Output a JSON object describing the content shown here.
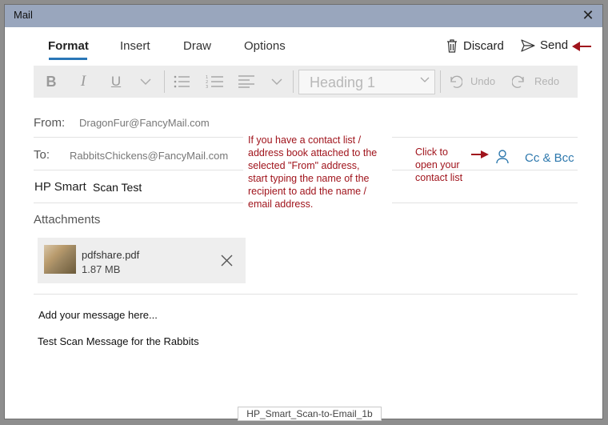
{
  "window": {
    "title": "Mail"
  },
  "tabs": [
    {
      "label": "Format",
      "active": true
    },
    {
      "label": "Insert",
      "active": false
    },
    {
      "label": "Draw",
      "active": false
    },
    {
      "label": "Options",
      "active": false
    }
  ],
  "actions": {
    "discard_label": "Discard",
    "send_label": "Send"
  },
  "toolbar": {
    "bold": "B",
    "italic": "I",
    "underline": "U",
    "heading_value": "Heading 1",
    "undo_label": "Undo",
    "redo_label": "Redo"
  },
  "form": {
    "from_label": "From:",
    "from_value": "DragonFur@FancyMail.com",
    "to_label": "To:",
    "to_value": "RabbitsChickens@FancyMail.com",
    "cc_bcc_label": "Cc & Bcc",
    "subject_label": "HP Smart",
    "subject_value": "Scan Test",
    "attachments_label": "Attachments"
  },
  "attachment": {
    "name": "pdfshare.pdf",
    "size": "1.87 MB"
  },
  "message": {
    "placeholder": "Add your message here...",
    "body": "Test Scan Message for the Rabbits"
  },
  "annotations": {
    "contact_note_lines": [
      "If you have a contact list /",
      "address book attached to the",
      "selected \"From\" address,",
      "start typing the name of the",
      "recipient to add the name /",
      "email address."
    ],
    "open_contacts_lines": [
      "Click to",
      "open your",
      "contact list"
    ],
    "caption": "HP_Smart_Scan-to-Email_1b"
  },
  "colors": {
    "accent": "#2a77b7",
    "annotation": "#a0141c",
    "titlebar": "#99a6bd"
  }
}
